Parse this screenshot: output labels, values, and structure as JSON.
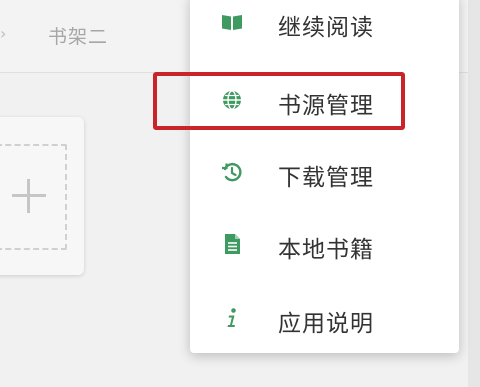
{
  "tabs": {
    "arrow": "›",
    "second_tab_label": "书架二"
  },
  "bookshelf": {
    "add_icon": "plus-icon"
  },
  "menu": {
    "items": [
      {
        "label": "继续阅读",
        "icon": "book-icon"
      },
      {
        "label": "书源管理",
        "icon": "globe-icon"
      },
      {
        "label": "下载管理",
        "icon": "history-icon"
      },
      {
        "label": "本地书籍",
        "icon": "document-icon"
      },
      {
        "label": "应用说明",
        "icon": "info-icon"
      }
    ],
    "highlighted_item": "书源管理"
  },
  "colors": {
    "icon_green": "#3f9a5f",
    "highlight_red": "#c8242a",
    "menu_text": "#333333",
    "tab_text": "#a6a6a6"
  }
}
